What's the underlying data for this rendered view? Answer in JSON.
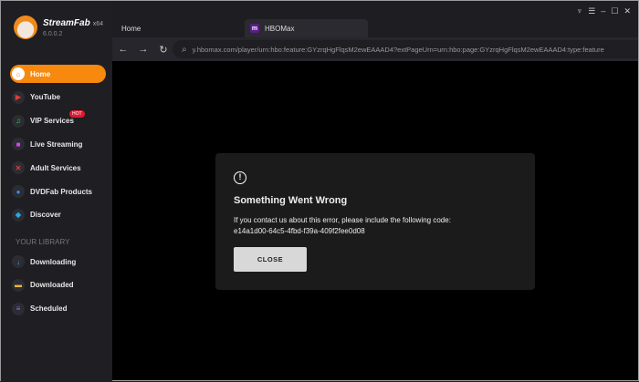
{
  "app": {
    "name": "StreamFab",
    "arch": "x64",
    "version": "6.0.0.2"
  },
  "sidebar": {
    "items": [
      {
        "label": "Home",
        "icon": "⌂",
        "color": "#f7890f"
      },
      {
        "label": "YouTube",
        "icon": "▶",
        "color": "#e53935"
      },
      {
        "label": "VIP Services",
        "icon": "♫",
        "color": "#2ecc40",
        "badge": "HOT"
      },
      {
        "label": "Live Streaming",
        "icon": "■",
        "color": "#e040fb"
      },
      {
        "label": "Adult Services",
        "icon": "✕",
        "color": "#e53935"
      },
      {
        "label": "DVDFab Products",
        "icon": "●",
        "color": "#3a8ee6"
      },
      {
        "label": "Discover",
        "icon": "◆",
        "color": "#2aa7e0"
      }
    ],
    "library_header": "YOUR LIBRARY",
    "library": [
      {
        "label": "Downloading",
        "icon": "↓",
        "color": "#3aa0ff"
      },
      {
        "label": "Downloaded",
        "icon": "▬",
        "color": "#f5b53a"
      },
      {
        "label": "Scheduled",
        "icon": "≡",
        "color": "#a06ae0"
      }
    ]
  },
  "tabs": [
    {
      "label": "Home"
    },
    {
      "label": "HBOMax",
      "icon": "m"
    }
  ],
  "address": {
    "url": "y.hbomax.com/player/urn:hbo:feature:GYzrqHgFlqsM2ewEAAAD4?extPageUrn=urn:hbo:page:GYzrqHgFlqsM2ewEAAAD4:type:feature"
  },
  "dialog": {
    "title": "Something Went Wrong",
    "message": "If you contact us about this error, please include the following code:",
    "code": "e14a1d00-64c5-4fbd-f39a-409f2fee0d08",
    "close": "CLOSE"
  }
}
